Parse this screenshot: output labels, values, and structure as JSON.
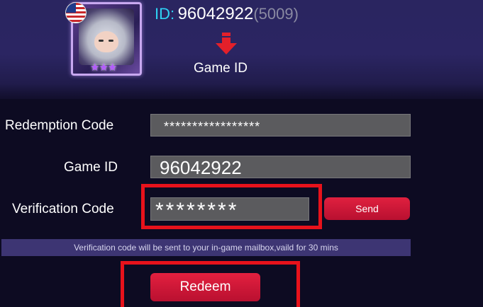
{
  "header": {
    "id_label": "ID:",
    "id_value": "96042922",
    "id_server": "(5009)",
    "caption": "Game ID",
    "flag_icon": "us-flag-icon",
    "arrow_icon": "down-arrow-icon"
  },
  "form": {
    "redemption_code": {
      "label": "Redemption Code",
      "value": "*****************"
    },
    "game_id": {
      "label": "Game ID",
      "value": "96042922"
    },
    "verification_code": {
      "label": "Verification Code",
      "value": "********"
    },
    "send_label": "Send",
    "notice": "Verification code will be sent to your in-game mailbox,vaild for 30 mins",
    "redeem_label": "Redeem"
  },
  "colors": {
    "accent_red": "#d81a38",
    "highlight_red": "#e8121b",
    "id_label_cyan": "#2fd2f5",
    "notice_bg": "#3d3573"
  }
}
